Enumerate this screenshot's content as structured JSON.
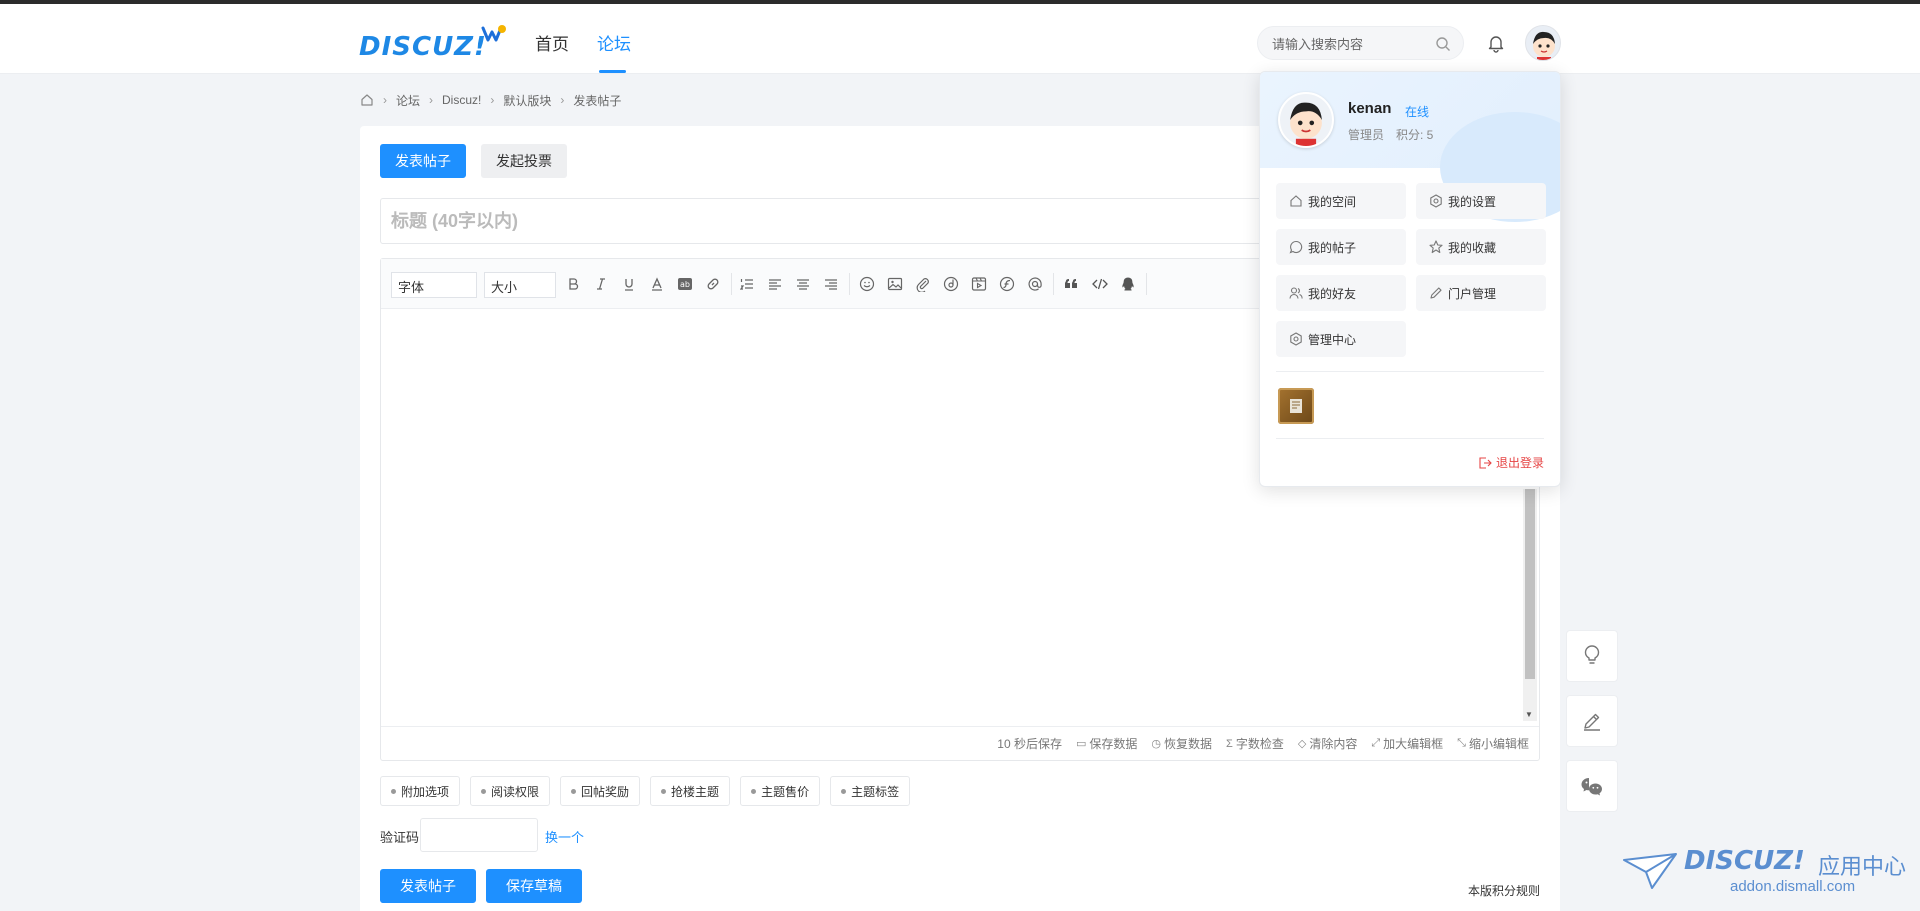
{
  "header": {
    "logo_text": "DISCUZ!",
    "nav": [
      {
        "label": "首页",
        "active": false
      },
      {
        "label": "论坛",
        "active": true
      }
    ],
    "search_placeholder": "请输入搜索内容"
  },
  "breadcrumb": [
    "论坛",
    "Discuz!",
    "默认版块",
    "发表帖子"
  ],
  "post_tabs": {
    "post": "发表帖子",
    "poll": "发起投票"
  },
  "title_placeholder": "标题 (40字以内)",
  "toolbar": {
    "font": "字体",
    "size": "大小"
  },
  "editor_footer": [
    "10 秒后保存",
    "保存数据",
    "恢复数据",
    "字数检查",
    "清除内容",
    "加大编辑框",
    "缩小编辑框"
  ],
  "options": [
    "附加选项",
    "阅读权限",
    "回帖奖励",
    "抢楼主题",
    "主题售价",
    "主题标签"
  ],
  "captcha": {
    "label": "验证码",
    "change": "换一个"
  },
  "actions": {
    "submit": "发表帖子",
    "draft": "保存草稿",
    "rules": "本版积分规则"
  },
  "user_menu": {
    "name": "kenan",
    "status": "在线",
    "role": "管理员",
    "points": "积分: 5",
    "items": [
      "我的空间",
      "我的设置",
      "我的帖子",
      "我的收藏",
      "我的好友",
      "门户管理",
      "管理中心"
    ],
    "logout": "退出登录"
  },
  "watermark": {
    "brand": "DISCUZ!",
    "cn": "应用中心",
    "url": "addon.dismall.com"
  },
  "colors": {
    "accent": "#1e90ff",
    "logout": "#e64545",
    "background": "#f2f4f7"
  }
}
